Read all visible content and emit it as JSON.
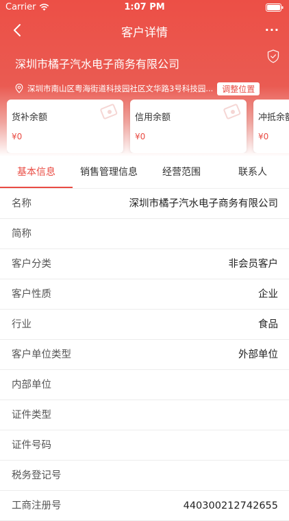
{
  "status_bar": {
    "carrier": "Carrier",
    "time": "1:07 PM"
  },
  "nav": {
    "title": "客户详情",
    "more": "···"
  },
  "company": {
    "name": "深圳市橘子汽水电子商务有限公司"
  },
  "address": {
    "text": "深圳市南山区粤海街道科技园社区文华路3号科技园...",
    "adjust_label": "调整位置"
  },
  "cards": [
    {
      "label": "货补余额",
      "value": "¥0"
    },
    {
      "label": "信用余额",
      "value": "¥0"
    },
    {
      "label": "冲抵余额",
      "value": "¥0"
    }
  ],
  "tabs": [
    {
      "label": "基本信息",
      "active": true
    },
    {
      "label": "销售管理信息",
      "active": false
    },
    {
      "label": "经营范围",
      "active": false
    },
    {
      "label": "联系人",
      "active": false
    }
  ],
  "rows": [
    {
      "key": "名称",
      "value": "深圳市橘子汽水电子商务有限公司"
    },
    {
      "key": "简称",
      "value": ""
    },
    {
      "key": "客户分类",
      "value": "非会员客户"
    },
    {
      "key": "客户性质",
      "value": "企业"
    },
    {
      "key": "行业",
      "value": "食品"
    },
    {
      "key": "客户单位类型",
      "value": "外部单位"
    },
    {
      "key": "内部单位",
      "value": ""
    },
    {
      "key": "证件类型",
      "value": ""
    },
    {
      "key": "证件号码",
      "value": ""
    },
    {
      "key": "税务登记号",
      "value": ""
    },
    {
      "key": "工商注册号",
      "value": "440300212742655"
    }
  ],
  "colors": {
    "accent": "#e94b43",
    "header": "#ec4f46"
  }
}
